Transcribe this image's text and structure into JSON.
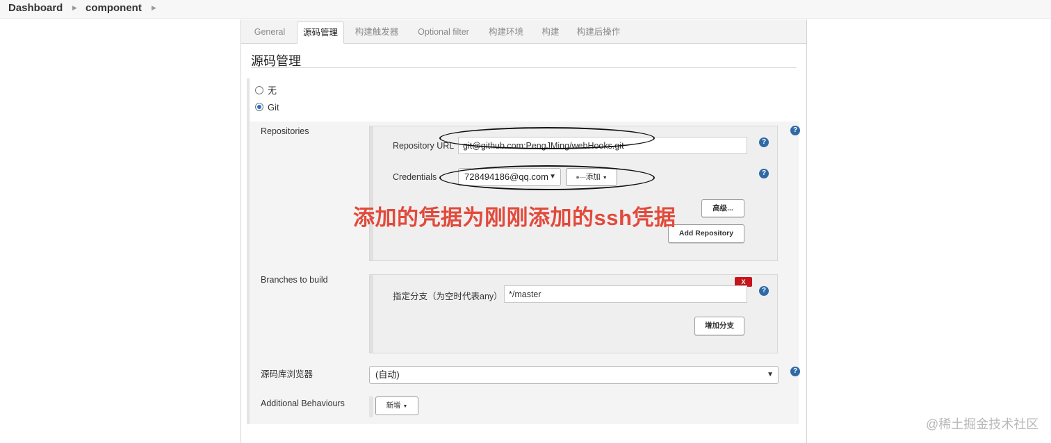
{
  "breadcrumb": {
    "items": [
      "Dashboard",
      "component"
    ],
    "separator": "›"
  },
  "tabs": [
    {
      "label": "General",
      "active": false
    },
    {
      "label": "源码管理",
      "active": true
    },
    {
      "label": "构建触发器",
      "active": false
    },
    {
      "label": "Optional filter",
      "active": false
    },
    {
      "label": "构建环境",
      "active": false
    },
    {
      "label": "构建",
      "active": false
    },
    {
      "label": "构建后操作",
      "active": false
    }
  ],
  "section": {
    "title": "源码管理",
    "options": [
      {
        "label": "无",
        "checked": false
      },
      {
        "label": "Git",
        "checked": true
      }
    ]
  },
  "repositories": {
    "label": "Repositories",
    "url_label": "Repository URL",
    "url_value": "git@github.com:PengJMing/webHooks.git",
    "credentials_label": "Credentials",
    "credentials_value": "728494186@qq.com",
    "add_button": "添加",
    "advanced_button": "高级...",
    "add_repository_button": "Add Repository"
  },
  "branches": {
    "label": "Branches to build",
    "delete_label": "X",
    "spec_label": "指定分支（为空时代表any）",
    "spec_value": "*/master",
    "add_branch_button": "增加分支"
  },
  "browser": {
    "label": "源码库浏览器",
    "value": "(自动)"
  },
  "behaviours": {
    "label": "Additional Behaviours",
    "add_button": "新增"
  },
  "help_glyph": "?",
  "annotation_text": "添加的凭据为刚刚添加的ssh凭据",
  "watermark": "@稀土掘金技术社区",
  "colors": {
    "annotation": "#e24a3b",
    "help_icon": "#2f6aa6",
    "delete_button": "#c8141c"
  }
}
